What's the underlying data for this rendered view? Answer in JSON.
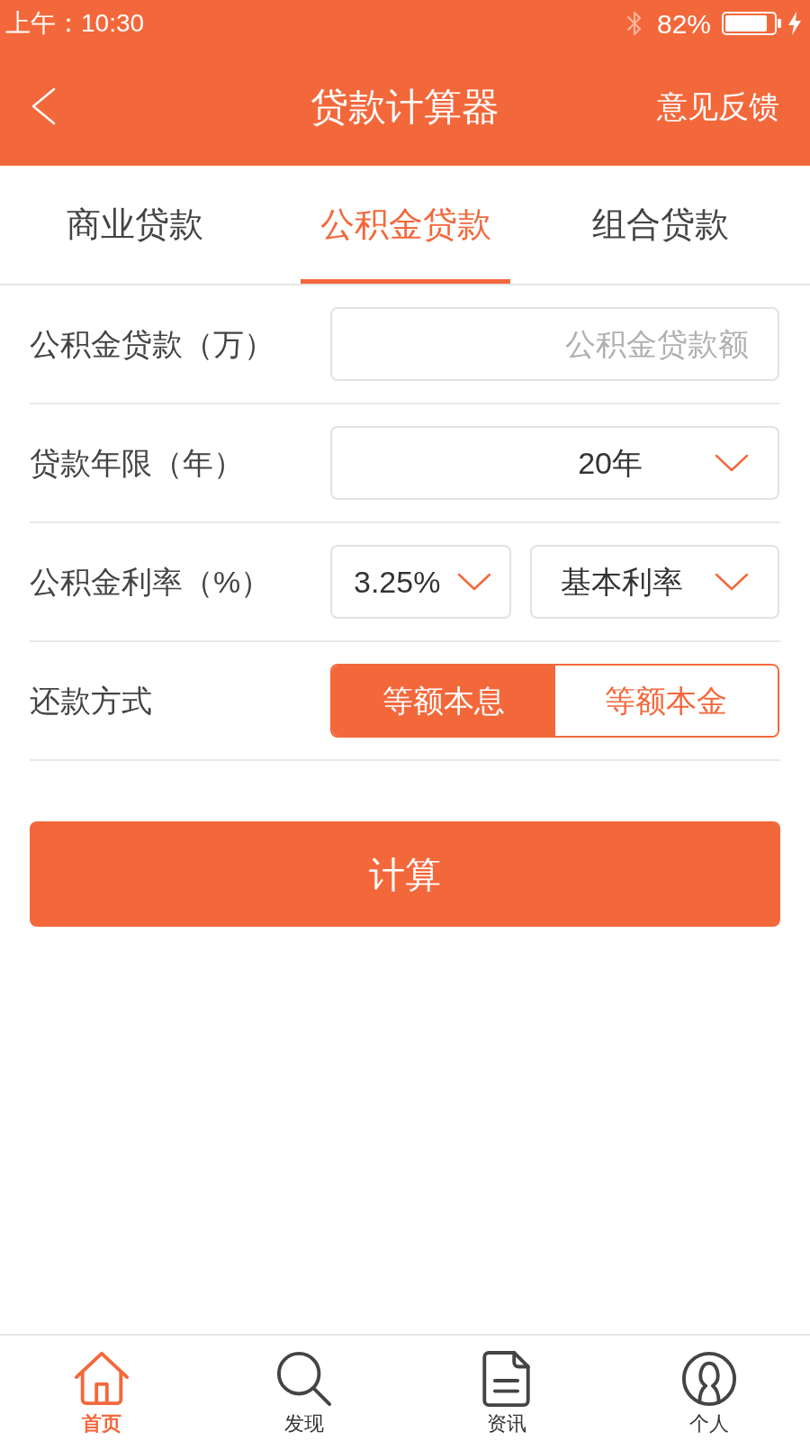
{
  "status_bar": {
    "time": "上午：10:30",
    "battery": "82%"
  },
  "header": {
    "title": "贷款计算器",
    "action": "意见反馈"
  },
  "tabs": [
    {
      "label": "商业贷款",
      "selected": false
    },
    {
      "label": "公积金贷款",
      "selected": true
    },
    {
      "label": "组合贷款",
      "selected": false
    }
  ],
  "form": [
    {
      "kind": "input",
      "label": "公积金贷款（万）",
      "placeholder": "公积金贷款额"
    },
    {
      "kind": "select",
      "label": "贷款年限（年）",
      "value": "20年"
    },
    {
      "kind": "double_select",
      "label": "公积金利率（%）",
      "values": [
        "3.25%",
        "基本利率"
      ]
    },
    {
      "kind": "toggle",
      "label": "还款方式",
      "options": [
        {
          "label": "等额本息",
          "selected": true
        },
        {
          "label": "等额本金",
          "selected": false
        }
      ]
    }
  ],
  "submit_button": "计算",
  "bottom_nav": [
    {
      "label": "首页",
      "selected": true
    },
    {
      "label": "发现",
      "selected": false
    },
    {
      "label": "资讯",
      "selected": false
    },
    {
      "label": "个人",
      "selected": false
    }
  ]
}
